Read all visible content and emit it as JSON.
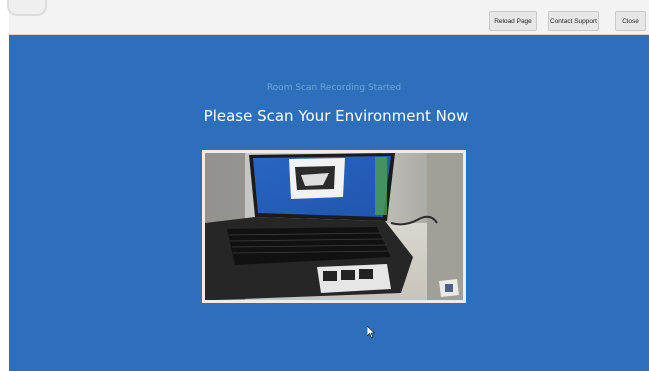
{
  "toolbar": {
    "reload_label": "Reload Page",
    "support_label": "Contact Support",
    "close_label": "Close"
  },
  "main": {
    "status": "Room Scan Recording Started",
    "headline": "Please Scan Your Environment Now"
  },
  "icons": {
    "cursor": "mouse-pointer-icon",
    "logo": "app-logo-icon"
  },
  "colors": {
    "content_background": "#2d6fbb",
    "toolbar_background": "#f3f3f3",
    "status_text": "#6fa4db",
    "headline_text": "#ffffff"
  }
}
